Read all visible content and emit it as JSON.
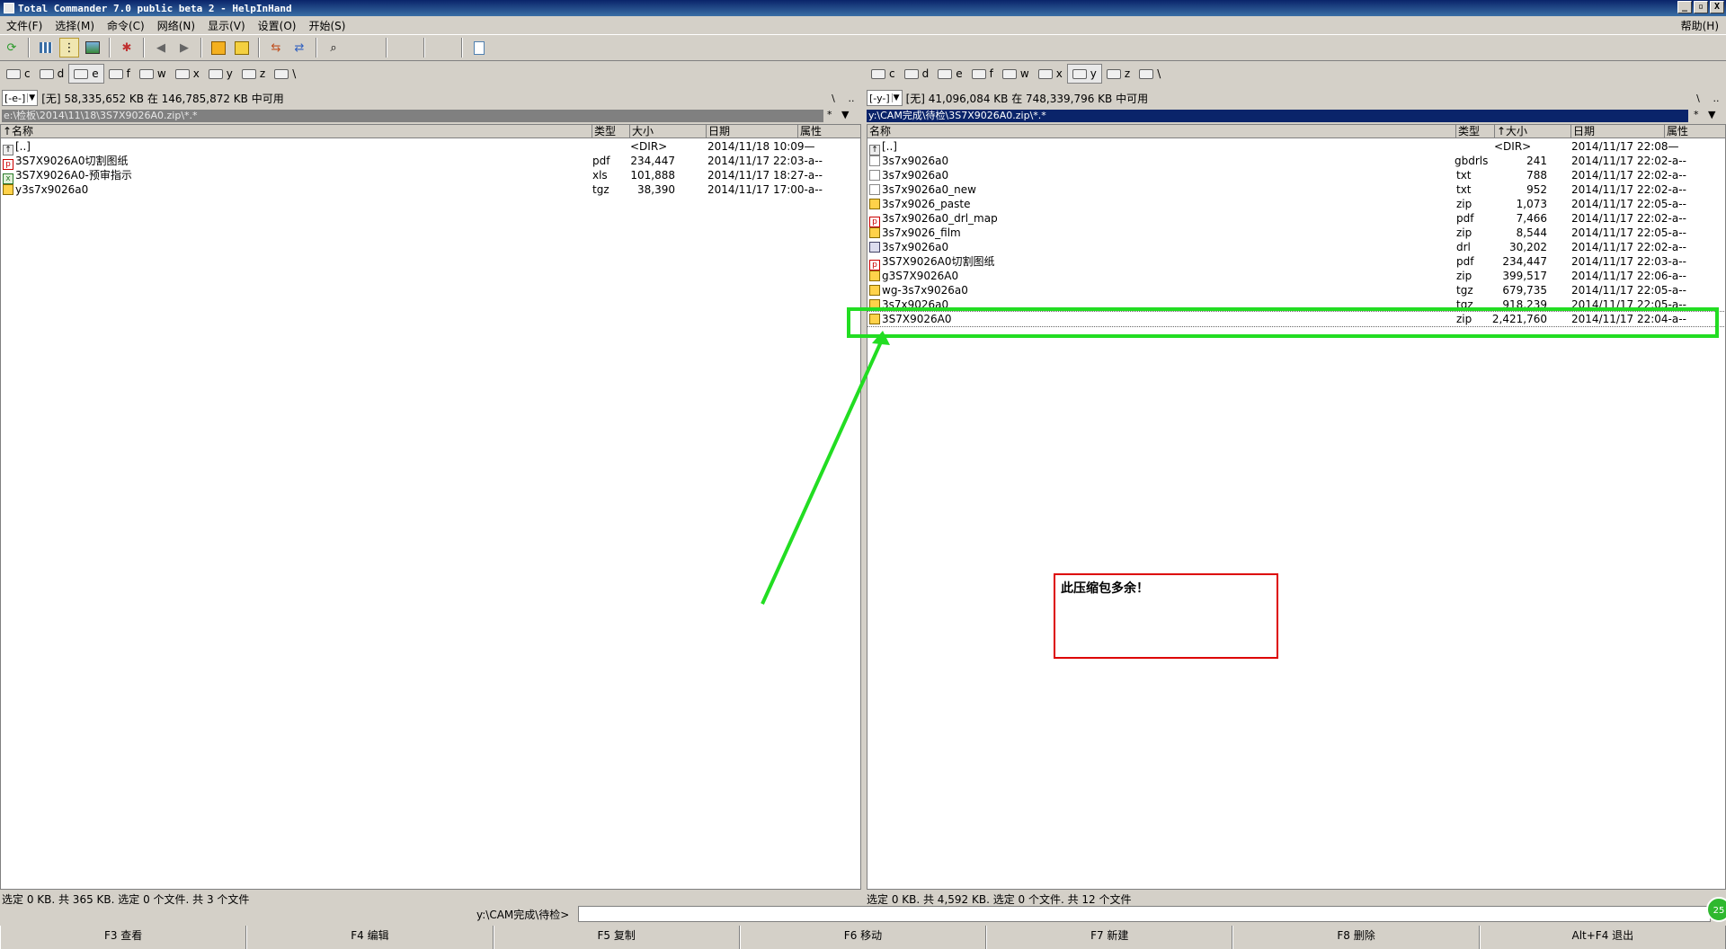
{
  "window": {
    "title": "Total Commander 7.0 public beta 2 - HelpInHand",
    "controls": [
      "_",
      "▫",
      "X"
    ]
  },
  "menu": {
    "items": [
      "文件(F)",
      "选择(M)",
      "命令(C)",
      "网络(N)",
      "显示(V)",
      "设置(O)",
      "开始(S)"
    ],
    "help": "帮助(H)"
  },
  "toolbar": {
    "icons": [
      "refresh-icon",
      "brief-view-icon",
      "tree-icon",
      "thumbnail-view-icon",
      "invert-selection-icon",
      "back-icon",
      "forward-icon",
      "pack-icon",
      "unpack-icon",
      "compare-dirs-icon",
      "sync-dirs-icon",
      "find-icon",
      "notepad-icon"
    ]
  },
  "left": {
    "drives": [
      "c",
      "d",
      "e",
      "f",
      "w",
      "x",
      "y",
      "z",
      "\\"
    ],
    "active_drive": "e",
    "drive_combo": "[-e-]",
    "free_space": "[无]  58,335,652 KB 在 146,785,872 KB 中可用",
    "path": "e:\\检板\\2014\\11\\18\\3S7X9026A0.zip\\*.*",
    "headers": {
      "name": "↑名称",
      "type": "类型",
      "size": "大小",
      "date": "日期",
      "attr": "属性"
    },
    "files": [
      {
        "icon": "up-dir-icon",
        "name": "[..]",
        "type": "",
        "size": "<DIR>",
        "date": "2014/11/18 10:09—",
        "attr": ""
      },
      {
        "icon": "pdf-file-icon",
        "name": "3S7X9026A0切割图纸",
        "type": "pdf",
        "size": "234,447",
        "date": "2014/11/17 22:03-a--",
        "attr": ""
      },
      {
        "icon": "excel-file-icon",
        "name": "3S7X9026A0-预审指示",
        "type": "xls",
        "size": "101,888",
        "date": "2014/11/17 18:27-a--",
        "attr": ""
      },
      {
        "icon": "archive-file-icon",
        "name": "y3s7x9026a0",
        "type": "tgz",
        "size": "38,390",
        "date": "2014/11/17 17:00-a--",
        "attr": ""
      }
    ],
    "status": "选定 0 KB. 共 365 KB. 选定 0 个文件. 共 3 个文件"
  },
  "right": {
    "drives": [
      "c",
      "d",
      "e",
      "f",
      "w",
      "x",
      "y",
      "z",
      "\\"
    ],
    "active_drive": "y",
    "drive_combo": "[-y-]",
    "free_space": "[无]  41,096,084 KB 在 748,339,796 KB 中可用",
    "path": "y:\\CAM完成\\待检\\3S7X9026A0.zip\\*.*",
    "headers": {
      "name": "名称",
      "type": "类型",
      "size": "↑大小",
      "date": "日期",
      "attr": "属性"
    },
    "files": [
      {
        "icon": "up-dir-icon",
        "name": "[..]",
        "type": "",
        "size": "<DIR>",
        "date": "2014/11/17 22:08—"
      },
      {
        "icon": "document-file-icon",
        "name": "3s7x9026a0",
        "type": "gbdrls",
        "size": "241",
        "date": "2014/11/17 22:02-a--"
      },
      {
        "icon": "document-file-icon",
        "name": "3s7x9026a0",
        "type": "txt",
        "size": "788",
        "date": "2014/11/17 22:02-a--"
      },
      {
        "icon": "document-file-icon",
        "name": "3s7x9026a0_new",
        "type": "txt",
        "size": "952",
        "date": "2014/11/17 22:02-a--"
      },
      {
        "icon": "archive-file-icon",
        "name": "3s7x9026_paste",
        "type": "zip",
        "size": "1,073",
        "date": "2014/11/17 22:05-a--"
      },
      {
        "icon": "pdf-file-icon",
        "name": "3s7x9026a0_drl_map",
        "type": "pdf",
        "size": "7,466",
        "date": "2014/11/17 22:02-a--"
      },
      {
        "icon": "archive-file-icon",
        "name": "3s7x9026_film",
        "type": "zip",
        "size": "8,544",
        "date": "2014/11/17 22:05-a--"
      },
      {
        "icon": "drill-file-icon",
        "name": "3s7x9026a0",
        "type": "drl",
        "size": "30,202",
        "date": "2014/11/17 22:02-a--"
      },
      {
        "icon": "pdf-file-icon",
        "name": "3S7X9026A0切割图纸",
        "type": "pdf",
        "size": "234,447",
        "date": "2014/11/17 22:03-a--"
      },
      {
        "icon": "archive-file-icon",
        "name": "g3S7X9026A0",
        "type": "zip",
        "size": "399,517",
        "date": "2014/11/17 22:06-a--"
      },
      {
        "icon": "archive-file-icon",
        "name": "wg-3s7x9026a0",
        "type": "tgz",
        "size": "679,735",
        "date": "2014/11/17 22:05-a--"
      },
      {
        "icon": "archive-file-icon",
        "name": "3s7x9026a0",
        "type": "tgz",
        "size": "918,239",
        "date": "2014/11/17 22:05-a--"
      },
      {
        "icon": "archive-file-icon",
        "name": "3S7X9026A0",
        "type": "zip",
        "size": "2,421,760",
        "date": "2014/11/17 22:04-a--"
      }
    ],
    "status": "选定 0 KB. 共 4,592 KB. 选定 0 个文件. 共 12 个文件"
  },
  "cmdline": {
    "label": "y:\\CAM完成\\待检>",
    "value": ""
  },
  "fkeys": [
    "F3 查看",
    "F4 编辑",
    "F5 复制",
    "F6 移动",
    "F7 新建",
    "F8 删除",
    "Alt+F4 退出"
  ],
  "annotation": {
    "note": "此压缩包多余！",
    "highlight_color": "#22dd22",
    "box_color": "#dd0000"
  },
  "tray_badge": "25"
}
